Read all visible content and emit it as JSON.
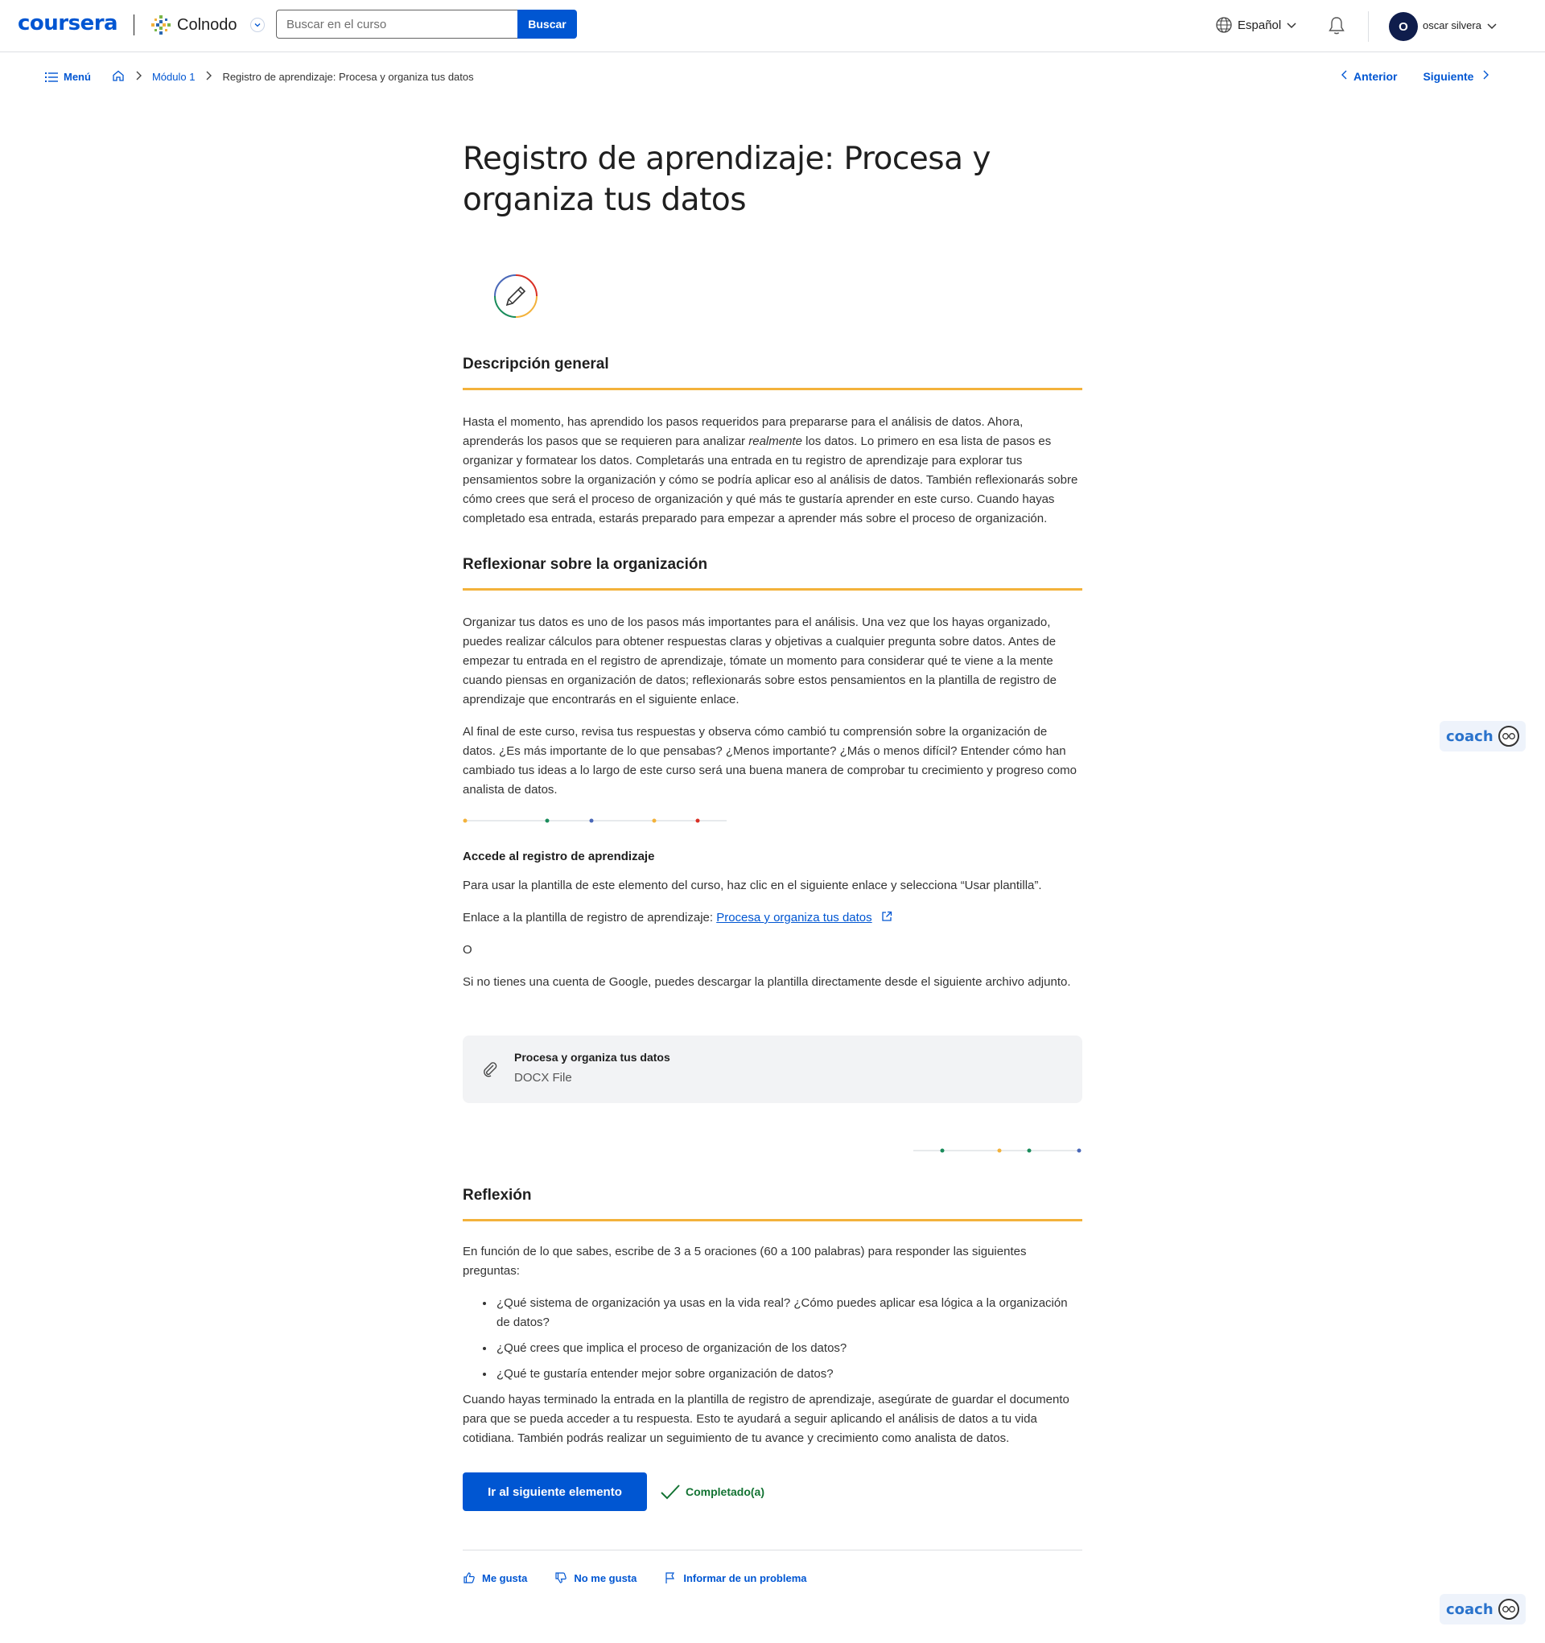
{
  "header": {
    "logo": "coursera",
    "partner": "Colnodo",
    "search_placeholder": "Buscar en el curso",
    "search_button": "Buscar",
    "language": "Español",
    "avatar_initial": "O",
    "username": "oscar silvera"
  },
  "breadcrumb": {
    "menu": "Menú",
    "module": "Módulo 1",
    "current": "Registro de aprendizaje: Procesa y organiza tus datos",
    "prev": "Anterior",
    "next": "Siguiente"
  },
  "page": {
    "title": "Registro de aprendizaje: Procesa y organiza tus datos",
    "overview_heading": "Descripción general",
    "overview_text_1": "Hasta el momento, has aprendido los pasos requeridos para prepararse para el análisis de datos. Ahora, aprenderás los pasos que se requieren para analizar ",
    "overview_em": "realmente",
    "overview_text_2": " los datos. Lo primero en esa lista de pasos es organizar y formatear los datos. Completarás una entrada en tu registro de aprendizaje para explorar tus pensamientos sobre la organización y cómo se podría aplicar eso al análisis de datos. También reflexionarás sobre cómo crees que será el proceso de organización y qué más te gustaría aprender en este curso. Cuando hayas completado esa entrada, estarás preparado para empezar a aprender más sobre el proceso de organización.",
    "reflect_heading": "Reflexionar sobre la organización",
    "reflect_p1": "Organizar tus datos es uno de los pasos más importantes para el análisis. Una vez que los hayas organizado, puedes realizar cálculos para obtener respuestas claras y objetivas a cualquier pregunta sobre datos. Antes de empezar tu entrada en el registro de aprendizaje, tómate un momento para considerar qué te viene a la mente cuando piensas en organización de datos; reflexionarás sobre estos pensamientos en la plantilla de registro de aprendizaje que encontrarás en el siguiente enlace.",
    "reflect_p2": "Al final de este curso, revisa tus respuestas y observa cómo cambió tu comprensión sobre la organización de datos. ¿Es más importante de lo que pensabas? ¿Menos importante? ¿Más o menos difícil? Entender cómo han cambiado tus ideas a lo largo de este curso será una buena manera de comprobar tu crecimiento y progreso como analista de datos.",
    "access_heading": "Accede al registro de aprendizaje",
    "access_p1": "Para usar la plantilla de este elemento del curso, haz clic en el siguiente enlace y selecciona “Usar plantilla”.",
    "access_link_prefix": "Enlace a la plantilla de registro de aprendizaje: ",
    "access_link_text": "Procesa y organiza tus datos",
    "access_or": "O",
    "access_p2": "Si no tienes una cuenta de Google, puedes descargar la plantilla directamente desde el siguiente archivo adjunto.",
    "attachment_name": "Procesa y organiza tus datos",
    "attachment_type": "DOCX File",
    "reflection_heading": "Reflexión",
    "reflection_intro": "En función de lo que sabes, escribe de 3 a 5 oraciones (60 a 100 palabras) para responder las siguientes preguntas:",
    "questions": [
      "¿Qué sistema de organización ya usas en la vida real? ¿Cómo puedes aplicar esa lógica a la organización de datos?",
      "¿Qué crees que implica el proceso de organización de los datos?",
      "¿Qué te gustaría entender mejor sobre organización de datos?"
    ],
    "reflection_outro": "Cuando hayas terminado la entrada en la plantilla de registro de aprendizaje, asegúrate de guardar el documento para que se pueda acceder a tu respuesta. Esto te ayudará a seguir aplicando el análisis de datos a tu vida cotidiana. También podrás realizar un seguimiento de tu avance y crecimiento como analista de datos.",
    "next_button": "Ir al siguiente elemento",
    "completed": "Completado(a)",
    "like": "Me gusta",
    "dislike": "No me gusta",
    "report": "Informar de un problema"
  },
  "coach": {
    "label": "coach"
  },
  "colors": {
    "primary": "#0056d2",
    "heading_rule": "#f3b23b",
    "completed": "#137333",
    "dot_colors": [
      "#f3b23b",
      "#1a8c5b",
      "#4a68b8",
      "#f3b23b",
      "#d93025"
    ]
  }
}
